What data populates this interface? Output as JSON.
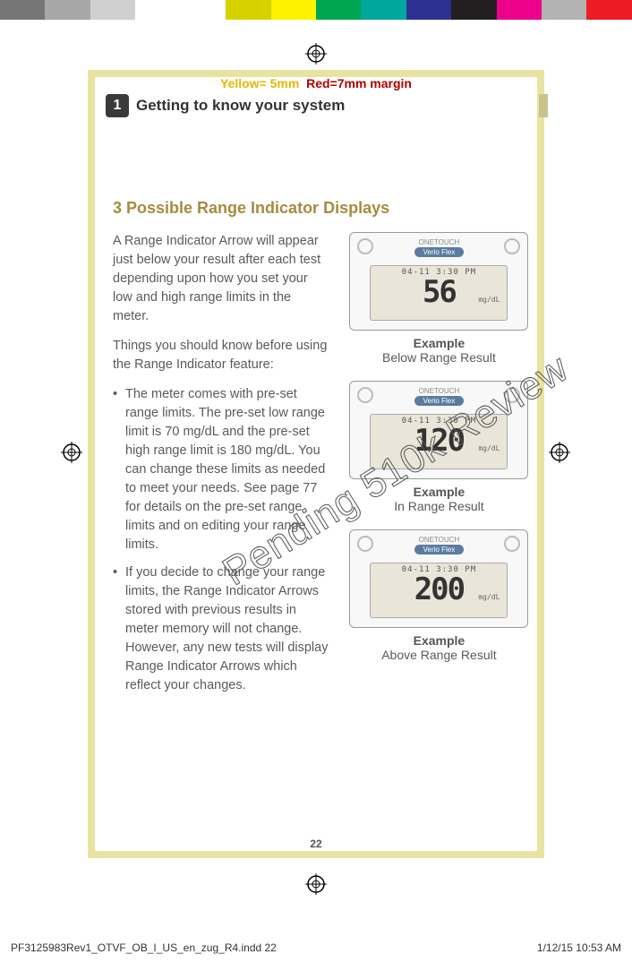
{
  "colorbar": [
    "#767676",
    "#a7a7a7",
    "#cfcfcf",
    "#ffffff",
    "#ffffff",
    "#d6d200",
    "#fff200",
    "#00a651",
    "#00a79d",
    "#2e3192",
    "#231f20",
    "#ec008c",
    "#b3b3b3",
    "#ed1c24"
  ],
  "margin_note": {
    "yellow": "Yellow= 5mm",
    "red": "Red=7mm margin"
  },
  "chapter": {
    "num": "1",
    "title": "Getting to know your system"
  },
  "subheading": "3 Possible Range Indicator Displays",
  "intro_p1": "A Range Indicator Arrow will appear just below your result after each test depending upon how you set your low and high range limits in the meter.",
  "intro_p2": "Things you should know before using the Range Indicator feature:",
  "bullets": [
    "The meter comes with pre-set range limits. The pre-set low range limit is 70 mg/dL and the pre-set high range limit is 180 mg/dL. You can change these limits as needed to meet your needs. See page 77 for details on the pre-set range limits and on editing your range limits.",
    "If you decide to change your range limits, the Range Indicator Arrows stored with previous results in meter memory will not change. However, any new tests will display Range Indicator Arrows which reflect your changes."
  ],
  "device_brand": "ONETOUCH",
  "device_tag": "Verio Flex",
  "screen_time": "04-11  3:30 PM",
  "screen_unit": "mg/dL",
  "figures": [
    {
      "value": "56",
      "cap1": "Example",
      "cap2": "Below Range Result"
    },
    {
      "value": "120",
      "cap1": "Example",
      "cap2": "In Range Result"
    },
    {
      "value": "200",
      "cap1": "Example",
      "cap2": "Above Range Result"
    }
  ],
  "watermark": "Pending 510k Review",
  "page_num": "22",
  "footer": {
    "left": "PF3125983Rev1_OTVF_OB_I_US_en_zug_R4.indd   22",
    "right": "1/12/15   10:53 AM"
  }
}
